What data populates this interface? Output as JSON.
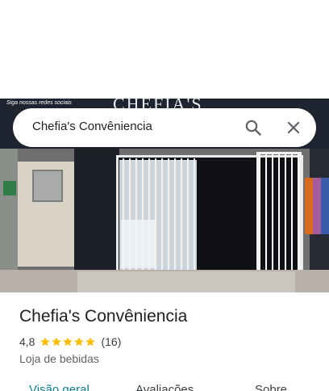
{
  "search": {
    "query": "Chefia's Convêniencia"
  },
  "photo": {
    "sign": "CHEFIA'S",
    "small_text": "Siga nossas redes sociais"
  },
  "place": {
    "name": "Chefia's Convêniencia",
    "rating": "4,8",
    "stars": 5,
    "review_count": "(16)",
    "category": "Loja de bebidas"
  },
  "tabs": [
    {
      "label": "Visão geral",
      "active": true
    },
    {
      "label": "Avaliações",
      "active": false
    },
    {
      "label": "Sobre",
      "active": false
    }
  ],
  "colors": {
    "accent": "#0b7e8b",
    "star": "#fbbc04"
  }
}
